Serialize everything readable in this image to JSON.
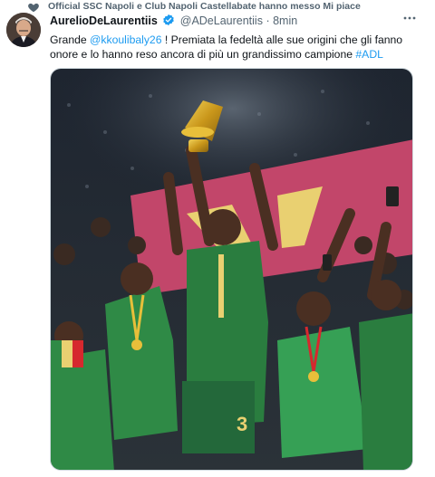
{
  "social_context": {
    "icon": "heart-icon",
    "text": "Official SSC Napoli e Club Napoli Castellabate hanno messo Mi piace"
  },
  "tweet": {
    "display_name": "AurelioDeLaurentiis",
    "verified_icon": "verified-badge-icon",
    "handle": "@ADeLaurentiis",
    "separator": "·",
    "time": "8min",
    "text": {
      "part1": "Grande ",
      "mention": "@kkoulibaly26",
      "part2": " ! Premiata la fedeltà alle sue origini che gli fanno onore e lo hanno reso ancora di più un grandissimo campione ",
      "hashtag": "#ADL"
    },
    "image": {
      "description_icon": "team-celebration-photo"
    }
  },
  "colors": {
    "link": "#1d9bf0",
    "secondary_text": "#536471",
    "jersey_green": "#2f8a46",
    "trophy_gold": "#d4a21a",
    "banner_pink": "#c2466a"
  }
}
